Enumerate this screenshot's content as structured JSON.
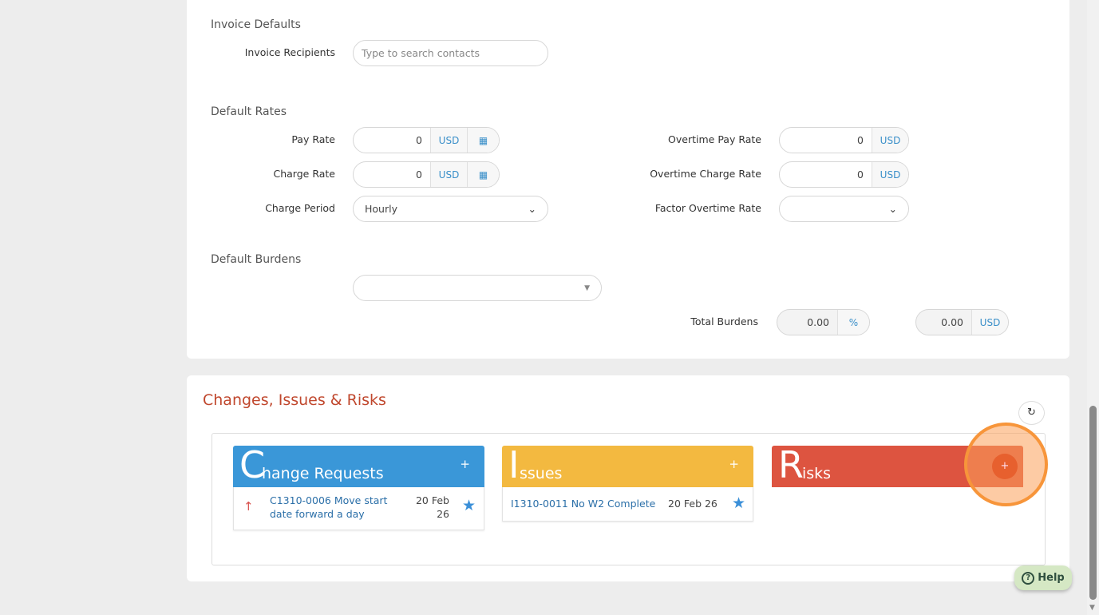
{
  "invoice_defaults": {
    "title": "Invoice Defaults",
    "recipients_label": "Invoice Recipients",
    "recipients_placeholder": "Type to search contacts"
  },
  "default_rates": {
    "title": "Default Rates",
    "pay_rate": {
      "label": "Pay Rate",
      "value": "0",
      "currency": "USD"
    },
    "charge_rate": {
      "label": "Charge Rate",
      "value": "0",
      "currency": "USD"
    },
    "charge_period": {
      "label": "Charge Period",
      "value": "Hourly"
    },
    "overtime_pay_rate": {
      "label": "Overtime Pay Rate",
      "value": "0",
      "currency": "USD"
    },
    "overtime_charge_rate": {
      "label": "Overtime Charge Rate",
      "value": "0",
      "currency": "USD"
    },
    "factor_overtime_rate": {
      "label": "Factor Overtime Rate",
      "value": ""
    }
  },
  "default_burdens": {
    "title": "Default Burdens",
    "total_label": "Total Burdens",
    "percent_value": "0.00",
    "percent_unit": "%",
    "usd_value": "0.00",
    "usd_unit": "USD"
  },
  "cir": {
    "title": "Changes, Issues & Risks",
    "change_requests": {
      "initial": "C",
      "rest": "hange Requests",
      "add": "+",
      "items": [
        {
          "text": "C1310-0006 Move start date forward a day",
          "date": "20 Feb 26"
        }
      ]
    },
    "issues": {
      "initial": "I",
      "rest": "ssues",
      "add": "+",
      "items": [
        {
          "text": "I1310-0011 No W2 Complete",
          "date": "20 Feb 26"
        }
      ]
    },
    "risks": {
      "initial": "R",
      "rest": "isks",
      "add": "+"
    }
  },
  "help": {
    "label": "Help"
  }
}
